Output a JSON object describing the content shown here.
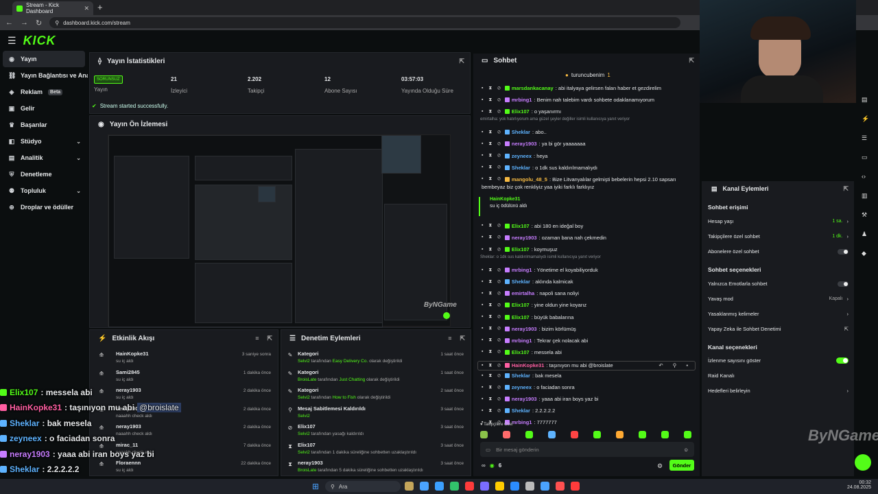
{
  "browser": {
    "tab_title": "Stream - Kick Dashboard",
    "url": "dashboard.kick.com/stream"
  },
  "brand": {
    "logo": "KICK",
    "accent": "#53fc18"
  },
  "nav": [
    {
      "label": "Yayın",
      "icon": "broadcast-icon",
      "active": true
    },
    {
      "label": "Yayın Bağlantısı ve Anahtarı",
      "icon": "link-icon"
    },
    {
      "label": "Reklam",
      "icon": "megaphone-icon",
      "badge": "Beta"
    },
    {
      "label": "Gelir",
      "icon": "dollar-icon"
    },
    {
      "label": "Başarılar",
      "icon": "trophy-icon"
    },
    {
      "label": "Stüdyo",
      "icon": "studio-icon",
      "chevron": true
    },
    {
      "label": "Analitik",
      "icon": "chart-icon",
      "chevron": true
    },
    {
      "label": "Denetleme",
      "icon": "shield-icon"
    },
    {
      "label": "Topluluk",
      "icon": "users-icon",
      "chevron": true
    },
    {
      "label": "Droplar ve ödüller",
      "icon": "gift-icon"
    }
  ],
  "stats": {
    "title": "Yayın İstatistikleri",
    "status_badge": "SORUNSUZ",
    "status_label": "Yayın",
    "items": [
      {
        "value": "21",
        "label": "İzleyici"
      },
      {
        "value": "2.202",
        "label": "Takipçi"
      },
      {
        "value": "12",
        "label": "Abone Sayısı"
      },
      {
        "value": "03:57:03",
        "label": "Yayında Olduğu Süre"
      }
    ],
    "message": "Stream started successfully."
  },
  "preview": {
    "title": "Yayın Ön İzlemesi",
    "watermark": "ByNGame"
  },
  "activity": {
    "title": "Etkinlik Akışı",
    "items": [
      {
        "name": "HainKopke31",
        "sub": "su iç aldı",
        "time": "3 saniye sonra"
      },
      {
        "name": "Sami2845",
        "sub": "su iç aldı",
        "time": "1 dakika önce"
      },
      {
        "name": "neray1903",
        "sub": "su iç aldı",
        "time": "2 dakika önce"
      },
      {
        "name": "neray1903",
        "sub": "naaahh check aldı",
        "time": "2 dakika önce"
      },
      {
        "name": "neray1903",
        "sub": "naaahh check aldı",
        "time": "2 dakika önce"
      },
      {
        "name": "mirac_11",
        "sub": "naaahh check aldı",
        "time": "7 dakika önce"
      },
      {
        "name": "Floraennn",
        "sub": "su iç aldı",
        "time": "22 dakika önce"
      }
    ]
  },
  "moderation": {
    "title": "Denetim Eylemleri",
    "items": [
      {
        "icon": "edit-icon",
        "title": "Kategori",
        "actor": "Selvi2",
        "mid": " tarafından ",
        "target": "Easy Delivery Co.",
        "rest": " olarak değiştirildi",
        "time": "1 saat önce"
      },
      {
        "icon": "edit-icon",
        "title": "Kategori",
        "actor": "BroisLate",
        "mid": " tarafından ",
        "target": "Just Chatting",
        "rest": " olarak değiştirildi",
        "time": "1 saat önce"
      },
      {
        "icon": "edit-icon",
        "title": "Kategori",
        "actor": "Selvi2",
        "mid": " tarafından ",
        "target": "How to Fish",
        "rest": " olarak değiştirildi",
        "time": "2 saat önce"
      },
      {
        "icon": "unpin-icon",
        "title": "Mesaj Sabitlemesi Kaldırıldı",
        "actor": "Selvi2",
        "mid": "",
        "target": "",
        "rest": "",
        "time": "3 saat önce"
      },
      {
        "icon": "ban-icon",
        "title": "Elix107",
        "actor": "Selvi2",
        "mid": " tarafından yasağı kaldırıldı",
        "target": "",
        "rest": "",
        "time": "3 saat önce"
      },
      {
        "icon": "hourglass-icon",
        "title": "Elix107",
        "actor": "Selvi2",
        "mid": " tarafından 1 dakika süreliğine sohbetten uzaklaştırıldı",
        "target": "",
        "rest": "",
        "time": "3 saat önce"
      },
      {
        "icon": "hourglass-icon",
        "title": "neray1903",
        "actor": "BroisLate",
        "mid": " tarafından 5 dakika süreliğine sohbetten uzaklaştırıldı",
        "target": "",
        "rest": "",
        "time": "3 saat önce"
      }
    ]
  },
  "chat": {
    "title": "Sohbet",
    "pinned_user": "turuncubenim",
    "pinned_count": "1",
    "messages": [
      {
        "user": "marsdankacanay",
        "color": "#53fc18",
        "text": ": abi italyaya gelirsen falan haber et gezdirelim"
      },
      {
        "user": "mrbing1",
        "color": "#c77dff",
        "text": ": Benim nah talebim vardı sohbete odaklanamıyorum"
      },
      {
        "user": "Elix107",
        "color": "#53fc18",
        "text": ": o yaşanırmı"
      },
      {
        "reply": "emirtalha: yok hatırlıyorum ama güzel şeyler değiller isimli kullanıcıya yanıt veriyor",
        "user": "Sheklar",
        "color": "#5eb3ff",
        "text": ": abo.."
      },
      {
        "user": "neray1903",
        "color": "#c77dff",
        "text": ": ya bi gör yaaaaaaa"
      },
      {
        "user": "zeyneex",
        "color": "#5eb3ff",
        "text": ": heya"
      },
      {
        "user": "Sheklar",
        "color": "#5eb3ff",
        "text": ": o 1dk sus kaldırılmamalıydı"
      },
      {
        "user": "mangolu_48_5",
        "color": "#f5b942",
        "text": ": Bize Litvanyalılar gelmişti bebelerin hepsi 2.10 sapsarı",
        "text2": "bembeyaz biz çok renkliyiz yaa iyiki farklı farklıyız"
      },
      {
        "highlight": true,
        "user": "HainKopke31",
        "text": "su iç ödülünü aldı"
      },
      {
        "user": "Elix107",
        "color": "#53fc18",
        "text": ": abi 180 en ideğal boy"
      },
      {
        "user": "neray1903",
        "color": "#c77dff",
        "text": ": ozaman bana nah çekmedin"
      },
      {
        "user": "Elix107",
        "color": "#53fc18",
        "text": ": koymuşuz"
      },
      {
        "reply": "Sheklar: o 1dk sus kaldırılmamalıydı isimli kullanıcıya yanıt veriyor",
        "user": "mrbing1",
        "color": "#c77dff",
        "text": ": Yönetime el koyabiliyorduk"
      },
      {
        "user": "Sheklar",
        "color": "#5eb3ff",
        "text": ": aklında kalmicak"
      },
      {
        "user": "emirtalha",
        "color": "#c77dff",
        "text": ": napoli sana noliyi"
      },
      {
        "user": "Elix107",
        "color": "#53fc18",
        "text": ": yine oldun yine koyarız"
      },
      {
        "user": "Elix107",
        "color": "#53fc18",
        "text": ": büyük babalarına"
      },
      {
        "user": "neray1903",
        "color": "#c77dff",
        "text": ": bizim körlümüş"
      },
      {
        "user": "mrbing1",
        "color": "#c77dff",
        "text": ": Tekrar çek nolacak abi"
      },
      {
        "user": "Elix107",
        "color": "#53fc18",
        "text": ": messela abi"
      },
      {
        "user": "HainKopke31",
        "color": "#ff5fa2",
        "text": ": taşınıyon mu abi @broislate",
        "selected": true
      },
      {
        "user": "Sheklar",
        "color": "#5eb3ff",
        "text": ": bak mesela"
      },
      {
        "user": "zeyneex",
        "color": "#5eb3ff",
        "text": ": o faciadan sonra"
      },
      {
        "user": "neray1903",
        "color": "#c77dff",
        "text": ": yaaa abi iran boys yaz bi"
      },
      {
        "user": "Sheklar",
        "color": "#5eb3ff",
        "text": ": 2.2.2.2.2"
      },
      {
        "user": "mrbing1",
        "color": "#c77dff",
        "text": ": 7777777"
      }
    ],
    "emote_bar_label": "Takipçilere Özel",
    "input_placeholder": "Bir mesaj gönderin",
    "points": "6",
    "send_label": "Gönder"
  },
  "channel_actions": {
    "title": "Kanal Eylemleri",
    "sections": [
      {
        "title": "Sohbet erişimi"
      },
      {
        "title": "Sohbet seçenekleri"
      },
      {
        "title": "Kanal seçenekleri"
      }
    ],
    "rows": {
      "account_age": {
        "label": "Hesap yaşı",
        "value": "1 sa."
      },
      "followers_only": {
        "label": "Takipçilere özel sohbet",
        "value": "1 dk."
      },
      "subs_only": {
        "label": "Abonelere özel sohbet",
        "toggle": false
      },
      "emote_only": {
        "label": "Yalnızca Emotlarla sohbet",
        "toggle": false
      },
      "slow_mode": {
        "label": "Yavaş mod",
        "value": "Kapalı"
      },
      "banned_words": {
        "label": "Yasaklanmış kelimeler"
      },
      "ai_mod": {
        "label": "Yapay Zeka ile Sohbet Denetimi"
      },
      "show_viewers": {
        "label": "İzlenme sayısını göster",
        "toggle": true
      },
      "raid": {
        "label": "Raid Kanalı"
      },
      "goals": {
        "label": "Hedefleri belirleyin"
      }
    }
  },
  "overlay_chat": [
    {
      "user": "Elix107",
      "color": "#53fc18",
      "text": ": messela abi"
    },
    {
      "user": "HainKopke31",
      "color": "#ff5fa2",
      "text": ": taşınıyon mu abi",
      "mention": "@broislate"
    },
    {
      "user": "Sheklar",
      "color": "#5eb3ff",
      "text": ": bak mesela"
    },
    {
      "user": "zeyneex",
      "color": "#5eb3ff",
      "text": ": o faciadan sonra"
    },
    {
      "user": "neray1903",
      "color": "#c77dff",
      "text": ": yaaa abi iran boys yaz bi"
    },
    {
      "user": "Sheklar",
      "color": "#5eb3ff",
      "text": ": 2.2.2.2.2"
    },
    {
      "user": "mrbing1",
      "color": "#c77dff",
      "text": ": 7777777"
    }
  ],
  "watermark": "ByNGame",
  "taskbar": {
    "search": "Ara",
    "time": "00:32",
    "date": "24.08.2025"
  }
}
